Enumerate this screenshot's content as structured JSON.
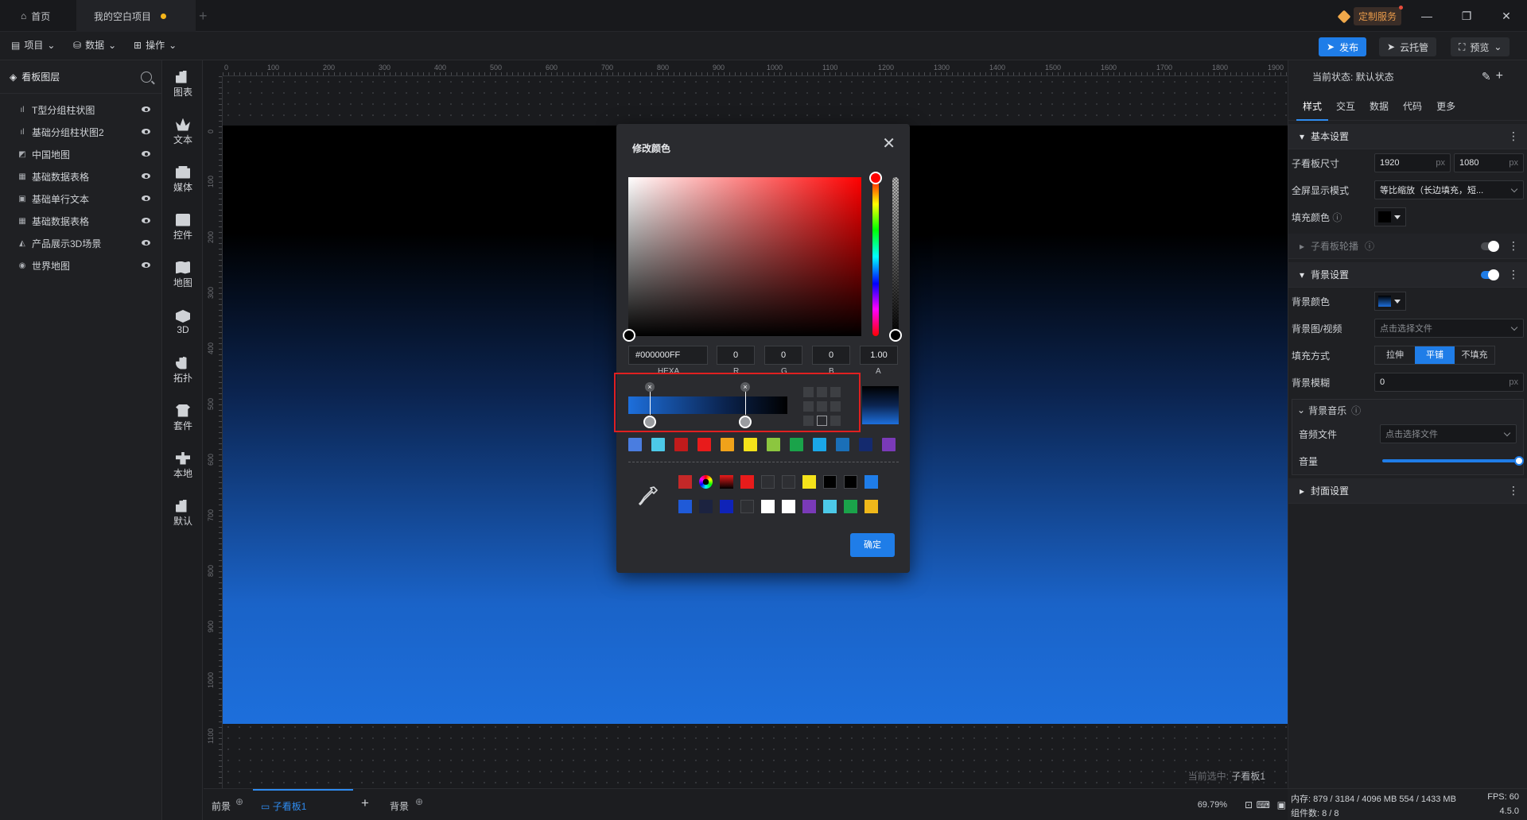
{
  "titlebar": {
    "tab_home": "首页",
    "tab_project": "我的空白项目",
    "custom_service": "定制服务"
  },
  "toolbar": {
    "menu_project": "项目",
    "menu_data": "数据",
    "menu_ops": "操作",
    "publish": "发布",
    "cloud": "云托管",
    "preview": "预览"
  },
  "layers": {
    "title": "看板图层",
    "items": [
      {
        "label": "T型分组柱状图",
        "icon": "bar-chart-icon"
      },
      {
        "label": "基础分组柱状图2",
        "icon": "bar-chart-icon"
      },
      {
        "label": "中国地图",
        "icon": "map-icon"
      },
      {
        "label": "基础数据表格",
        "icon": "table-icon"
      },
      {
        "label": "基础单行文本",
        "icon": "text-icon"
      },
      {
        "label": "基础数据表格",
        "icon": "table-icon"
      },
      {
        "label": "产品展示3D场景",
        "icon": "3d-icon"
      },
      {
        "label": "世界地图",
        "icon": "globe-icon"
      }
    ]
  },
  "components": [
    "图表",
    "文本",
    "媒体",
    "控件",
    "地图",
    "3D",
    "拓扑",
    "套件",
    "本地",
    "默认"
  ],
  "ruler": {
    "top": [
      "0",
      "100",
      "200",
      "300",
      "400",
      "500",
      "600",
      "700",
      "800",
      "900",
      "1000",
      "1100",
      "1200",
      "1300",
      "1400",
      "1500",
      "1600",
      "1700",
      "1800",
      "1900"
    ],
    "left": [
      "0",
      "100",
      "200",
      "300",
      "400",
      "500",
      "600",
      "700",
      "800",
      "900",
      "1000",
      "1100"
    ]
  },
  "canvas": {
    "selected_prefix": "当前选中:",
    "selected_name": "子看板1"
  },
  "bottom": {
    "front": "前景",
    "board": "子看板1",
    "background": "背景",
    "zoom": "69.79%"
  },
  "dialog": {
    "title": "修改颜色",
    "hex": "#000000FF",
    "r": "0",
    "g": "0",
    "b": "0",
    "a": "1.00",
    "label_hexa": "HEXA",
    "label_r": "R",
    "label_g": "G",
    "label_b": "B",
    "label_a": "A",
    "ok": "确定",
    "presets": [
      "#4a7de0",
      "#4cc9e8",
      "#c11b1b",
      "#e81b1b",
      "#f0a21a",
      "#f4e21a",
      "#8cc63f",
      "#1aa34a",
      "#1aa7e8",
      "#1a6fb8",
      "#142a6e",
      "#7a3ab8"
    ],
    "recent": [
      "#c42828",
      "conic",
      "#7a0000",
      "#e81b1b",
      "#2e2f33",
      "#2e2f33",
      "#f4e21a",
      "#000000",
      "#000000",
      "#1f7de8",
      "#1f5ad8",
      "#1c2340",
      "#0f23b8",
      "#2e2f33",
      "#ffffff",
      "#ffffff",
      "#7a3ab8",
      "#4cc9e8",
      "#1aa34a",
      "#f0b81a"
    ]
  },
  "props": {
    "state": "当前状态:  默认状态",
    "tabs": [
      "样式",
      "交互",
      "数据",
      "代码",
      "更多"
    ],
    "basic": "基本设置",
    "board_size": "子看板尺寸",
    "width": "1920",
    "height": "1080",
    "unit": "px",
    "fullscreen": "全屏显示模式",
    "fullscreen_value": "等比缩放（长边填充，短...",
    "fill_color": "填充颜色",
    "carousel": "子看板轮播",
    "bg_settings": "背景设置",
    "bg_color": "背景颜色",
    "bg_media": "背景图/视频",
    "choose_file": "点击选择文件",
    "fill_mode": "填充方式",
    "fill_modes": [
      "拉伸",
      "平铺",
      "不填充"
    ],
    "bg_blur": "背景模糊",
    "blur_value": "0",
    "bg_music": "背景音乐",
    "audio_file": "音频文件",
    "volume": "音量",
    "cover": "封面设置"
  },
  "status": {
    "memory": "内存:  879 / 3184 / 4096 MB  554 / 1433 MB",
    "fps": "FPS:  60",
    "components": "组件数: 8 / 8",
    "version": "4.5.0"
  },
  "colors": {
    "accent": "#1f7de8",
    "highlight": "#e02020"
  }
}
